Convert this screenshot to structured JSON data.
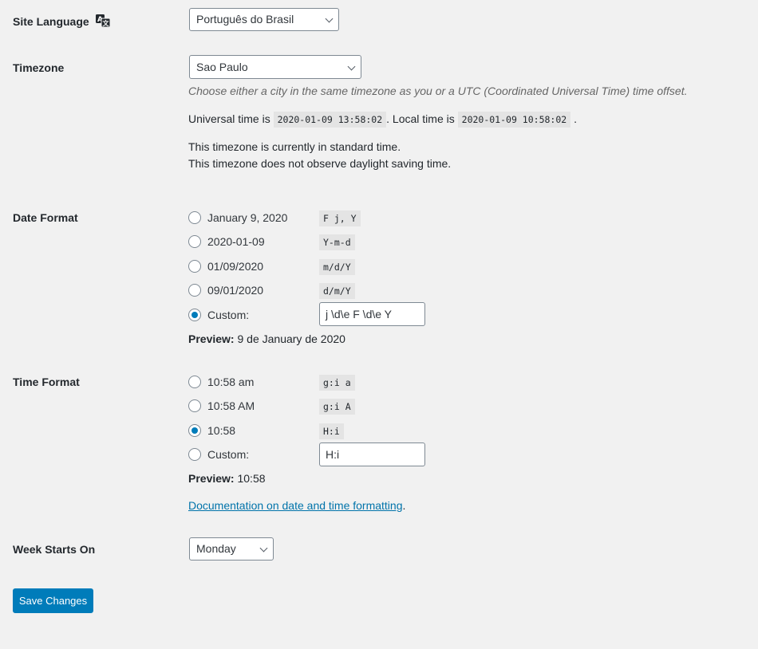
{
  "site_language": {
    "label": "Site Language",
    "icon": "translation-icon",
    "value": "Português do Brasil"
  },
  "timezone": {
    "label": "Timezone",
    "value": "Sao Paulo",
    "description": "Choose either a city in the same timezone as you or a UTC (Coordinated Universal Time) time offset.",
    "universal_prefix": "Universal time is",
    "universal_time": "2020-01-09 13:58:02",
    "local_prefix": ". Local time is",
    "local_time": "2020-01-09 10:58:02",
    "local_suffix": ".",
    "standard_note": "This timezone is currently in standard time.",
    "dst_note": "This timezone does not observe daylight saving time."
  },
  "date_format": {
    "label": "Date Format",
    "options": [
      {
        "label": "January 9, 2020",
        "code": "F j, Y",
        "checked": false
      },
      {
        "label": "2020-01-09",
        "code": "Y-m-d",
        "checked": false
      },
      {
        "label": "01/09/2020",
        "code": "m/d/Y",
        "checked": false
      },
      {
        "label": "09/01/2020",
        "code": "d/m/Y",
        "checked": false
      }
    ],
    "custom_label": "Custom:",
    "custom_checked": true,
    "custom_value": "j \\d\\e F \\d\\e Y",
    "preview_label": "Preview:",
    "preview_value": "9 de January de 2020"
  },
  "time_format": {
    "label": "Time Format",
    "options": [
      {
        "label": "10:58 am",
        "code": "g:i a",
        "checked": false
      },
      {
        "label": "10:58 AM",
        "code": "g:i A",
        "checked": false
      },
      {
        "label": "10:58",
        "code": "H:i",
        "checked": true
      }
    ],
    "custom_label": "Custom:",
    "custom_checked": false,
    "custom_value": "H:i",
    "preview_label": "Preview:",
    "preview_value": "10:58",
    "doc_link": "Documentation on date and time formatting",
    "doc_suffix": "."
  },
  "week_starts": {
    "label": "Week Starts On",
    "value": "Monday"
  },
  "save_button": "Save Changes",
  "colors": {
    "accent": "#007cba",
    "link": "#0073aa",
    "background": "#f1f1f1"
  }
}
